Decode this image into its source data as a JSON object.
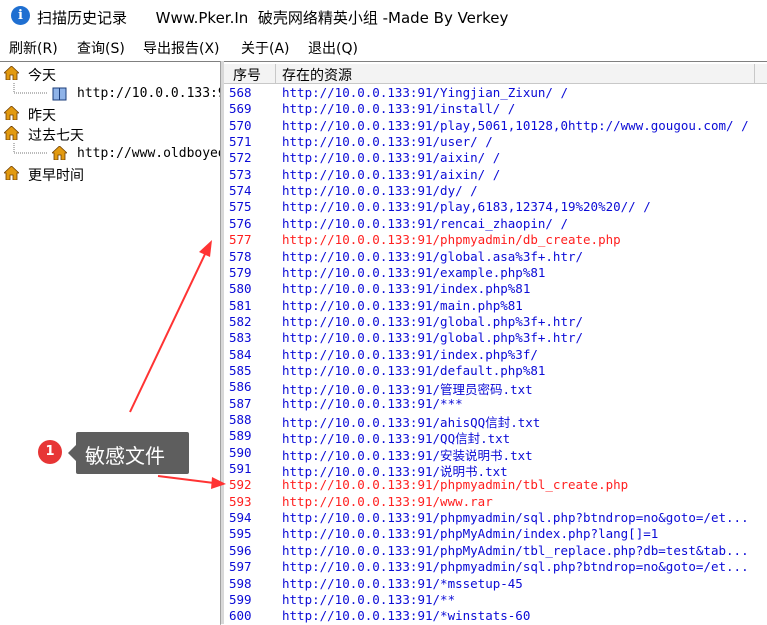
{
  "window": {
    "title": "扫描历史记录      Www.Pker.In  破壳网络精英小组 -Made By Verkey"
  },
  "menu": [
    {
      "label": "刷新(R)"
    },
    {
      "label": "查询(S)"
    },
    {
      "label": "导出报告(X)"
    },
    {
      "label": "关于(A)"
    },
    {
      "label": "退出(Q)"
    }
  ],
  "tree": {
    "today": "今天",
    "today_child": "http://10.0.0.133:9",
    "yesterday": "昨天",
    "last_seven_days": "过去七天",
    "seven_child": "http://www.oldboyed",
    "earlier": "更早时间"
  },
  "list": {
    "columns": [
      "序号",
      "存在的资源"
    ],
    "rows": [
      {
        "num": "568",
        "url": "http://10.0.0.133:91/Yingjian_Zixun/ /",
        "hl": false
      },
      {
        "num": "569",
        "url": "http://10.0.0.133:91/install/ /",
        "hl": false
      },
      {
        "num": "570",
        "url": "http://10.0.0.133:91/play,5061,10128,0http://www.gougou.com/ /",
        "hl": false
      },
      {
        "num": "571",
        "url": "http://10.0.0.133:91/user/ /",
        "hl": false
      },
      {
        "num": "572",
        "url": "http://10.0.0.133:91/aixin/ /",
        "hl": false
      },
      {
        "num": "573",
        "url": "http://10.0.0.133:91/aixin/ /",
        "hl": false
      },
      {
        "num": "574",
        "url": "http://10.0.0.133:91/dy/ /",
        "hl": false
      },
      {
        "num": "575",
        "url": "http://10.0.0.133:91/play,6183,12374,19%20%20// /",
        "hl": false
      },
      {
        "num": "576",
        "url": "http://10.0.0.133:91/rencai_zhaopin/ /",
        "hl": false
      },
      {
        "num": "577",
        "url": "http://10.0.0.133:91/phpmyadmin/db_create.php",
        "hl": true
      },
      {
        "num": "578",
        "url": "http://10.0.0.133:91/global.asa%3f+.htr/",
        "hl": false
      },
      {
        "num": "579",
        "url": "http://10.0.0.133:91/example.php%81",
        "hl": false
      },
      {
        "num": "580",
        "url": "http://10.0.0.133:91/index.php%81",
        "hl": false
      },
      {
        "num": "581",
        "url": "http://10.0.0.133:91/main.php%81",
        "hl": false
      },
      {
        "num": "582",
        "url": "http://10.0.0.133:91/global.php%3f+.htr/",
        "hl": false
      },
      {
        "num": "583",
        "url": "http://10.0.0.133:91/global.php%3f+.htr/",
        "hl": false
      },
      {
        "num": "584",
        "url": "http://10.0.0.133:91/index.php%3f/",
        "hl": false
      },
      {
        "num": "585",
        "url": "http://10.0.0.133:91/default.php%81",
        "hl": false
      },
      {
        "num": "586",
        "url": "http://10.0.0.133:91/管理员密码.txt",
        "hl": false
      },
      {
        "num": "587",
        "url": "http://10.0.0.133:91/***",
        "hl": false
      },
      {
        "num": "588",
        "url": "http://10.0.0.133:91/ahisQQ信封.txt",
        "hl": false
      },
      {
        "num": "589",
        "url": "http://10.0.0.133:91/QQ信封.txt",
        "hl": false
      },
      {
        "num": "590",
        "url": "http://10.0.0.133:91/安装说明书.txt",
        "hl": false
      },
      {
        "num": "591",
        "url": "http://10.0.0.133:91/说明书.txt",
        "hl": false
      },
      {
        "num": "592",
        "url": "http://10.0.0.133:91/phpmyadmin/tbl_create.php",
        "hl": true
      },
      {
        "num": "593",
        "url": "http://10.0.0.133:91/www.rar",
        "hl": true
      },
      {
        "num": "594",
        "url": "http://10.0.0.133:91/phpmyadmin/sql.php?btndrop=no&goto=/et...",
        "hl": false
      },
      {
        "num": "595",
        "url": "http://10.0.0.133:91/phpMyAdmin/index.php?lang[]=1",
        "hl": false
      },
      {
        "num": "596",
        "url": "http://10.0.0.133:91/phpMyAdmin/tbl_replace.php?db=test&tab...",
        "hl": false
      },
      {
        "num": "597",
        "url": "http://10.0.0.133:91/phpmyadmin/sql.php?btndrop=no&goto=/et...",
        "hl": false
      },
      {
        "num": "598",
        "url": "http://10.0.0.133:91/*mssetup-45",
        "hl": false
      },
      {
        "num": "599",
        "url": "http://10.0.0.133:91/**",
        "hl": false
      },
      {
        "num": "600",
        "url": "http://10.0.0.133:91/*winstats-60",
        "hl": false
      }
    ]
  },
  "annotation": {
    "badge": "1",
    "text": "敏感文件",
    "color": "#ff3333"
  }
}
